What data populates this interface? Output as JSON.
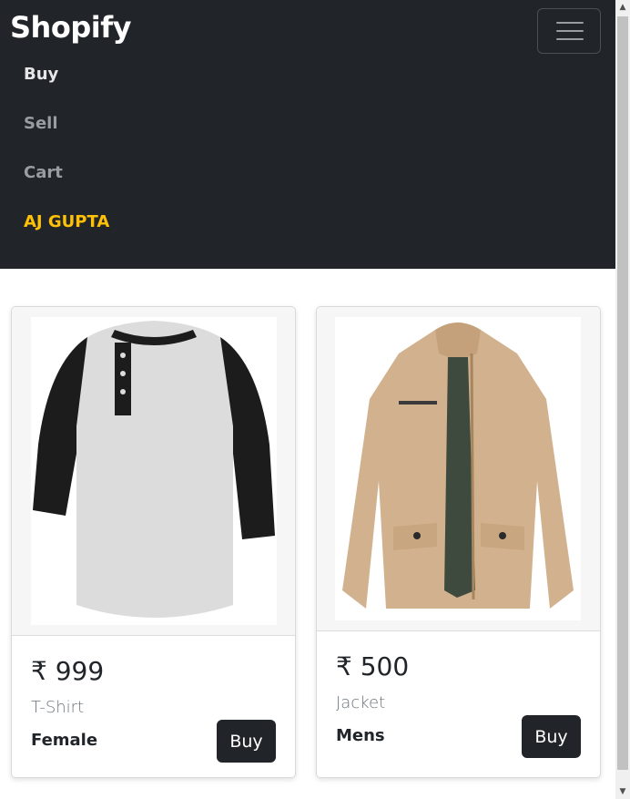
{
  "navbar": {
    "brand": "Shopify",
    "items": [
      {
        "label": "Buy"
      },
      {
        "label": "Sell"
      },
      {
        "label": "Cart"
      },
      {
        "label": "AJ GUPTA"
      }
    ]
  },
  "products": [
    {
      "price": "₹ 999",
      "name": "T-Shirt",
      "gender": "Female",
      "buy_label": "Buy"
    },
    {
      "price": "₹ 500",
      "name": "Jacket",
      "gender": "Mens",
      "buy_label": "Buy"
    }
  ],
  "colors": {
    "navbar_bg": "#212529",
    "user_accent": "#ffc107",
    "button_bg": "#212529"
  }
}
